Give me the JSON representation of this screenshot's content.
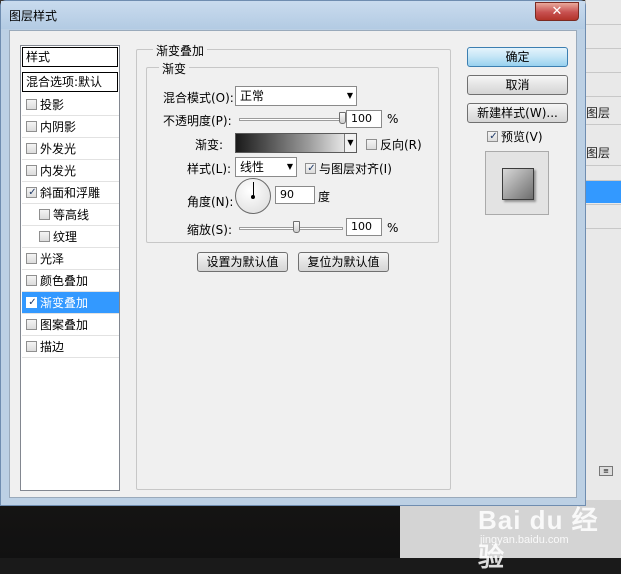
{
  "window": {
    "title": "图层样式",
    "close_glyph": "✕"
  },
  "styles_panel": {
    "header": "样式",
    "blend_header": "混合选项:默认",
    "items": [
      {
        "label": "投影",
        "checked": false,
        "indent": false,
        "selected": false
      },
      {
        "label": "内阴影",
        "checked": false,
        "indent": false,
        "selected": false
      },
      {
        "label": "外发光",
        "checked": false,
        "indent": false,
        "selected": false
      },
      {
        "label": "内发光",
        "checked": false,
        "indent": false,
        "selected": false
      },
      {
        "label": "斜面和浮雕",
        "checked": true,
        "indent": false,
        "selected": false
      },
      {
        "label": "等高线",
        "checked": false,
        "indent": true,
        "selected": false
      },
      {
        "label": "纹理",
        "checked": false,
        "indent": true,
        "selected": false
      },
      {
        "label": "光泽",
        "checked": false,
        "indent": false,
        "selected": false
      },
      {
        "label": "颜色叠加",
        "checked": false,
        "indent": false,
        "selected": false
      },
      {
        "label": "渐变叠加",
        "checked": true,
        "indent": false,
        "selected": true
      },
      {
        "label": "图案叠加",
        "checked": false,
        "indent": false,
        "selected": false
      },
      {
        "label": "描边",
        "checked": false,
        "indent": false,
        "selected": false
      }
    ]
  },
  "gradient_overlay": {
    "section_title": "渐变叠加",
    "subsection_title": "渐变",
    "blend_mode": {
      "label": "混合模式(O):",
      "value": "正常"
    },
    "opacity": {
      "label": "不透明度(P):",
      "value": "100",
      "unit": "%",
      "fraction": 1.0
    },
    "gradient": {
      "label": "渐变:"
    },
    "reverse": {
      "label": "反向(R)",
      "checked": false
    },
    "style": {
      "label": "样式(L):",
      "value": "线性"
    },
    "align_with_layer": {
      "label": "与图层对齐(I)",
      "checked": true
    },
    "angle": {
      "label": "角度(N):",
      "value": "90",
      "unit": "度",
      "degrees": 90
    },
    "scale": {
      "label": "缩放(S):",
      "value": "100",
      "unit": "%",
      "fraction": 0.4
    },
    "make_default_label": "设置为默认值",
    "reset_default_label": "复位为默认值"
  },
  "actions": {
    "ok_label": "确定",
    "cancel_label": "取消",
    "new_style_label": "新建样式(W)...",
    "preview_label": "预览(V)",
    "preview_checked": true
  },
  "background": {
    "layer_label_1": "图层",
    "layer_label_2": "图层",
    "watermark_main": "Bai du 经验",
    "watermark_url": "jingyan.baidu.com"
  }
}
